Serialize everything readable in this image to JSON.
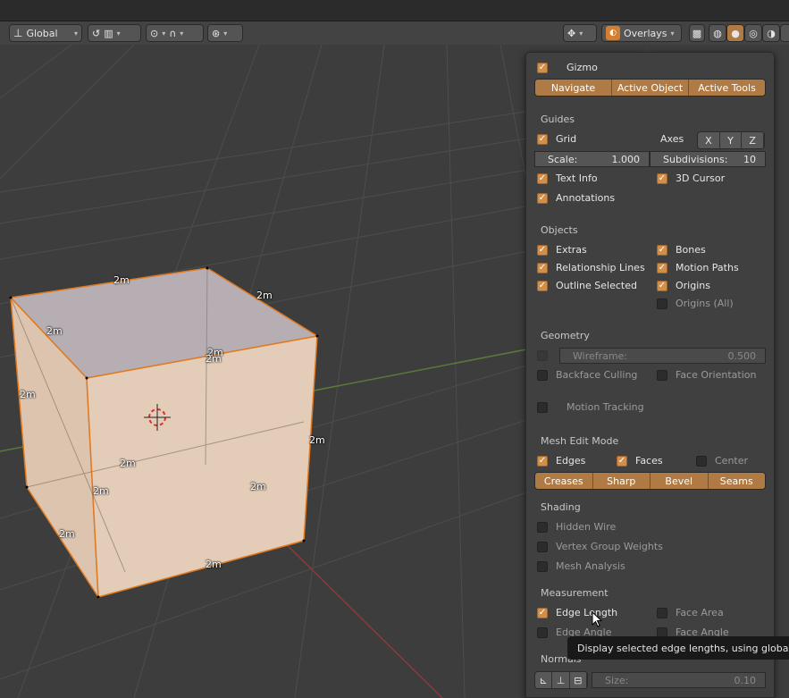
{
  "header": {
    "orientation": "Global",
    "overlays_label": "Overlays"
  },
  "viewport": {
    "measurements": [
      "2m",
      "2m",
      "2m",
      "2m",
      "2m",
      "2m",
      "2m",
      "2m",
      "2m",
      "2m",
      "2m",
      "2m",
      "2m",
      "2m"
    ]
  },
  "overlay": {
    "gizmo": {
      "label": "Gizmo",
      "checked": true,
      "buttons": [
        "Navigate",
        "Active Object",
        "Active Tools"
      ]
    },
    "guides": {
      "title": "Guides",
      "grid": "Grid",
      "axes_label": "Axes",
      "axes": [
        "X",
        "Y",
        "Z"
      ],
      "scale_label": "Scale:",
      "scale_value": "1.000",
      "subdivisions_label": "Subdivisions:",
      "subdivisions_value": "10",
      "text_info": "Text Info",
      "cursor_3d": "3D Cursor",
      "annotations": "Annotations"
    },
    "objects": {
      "title": "Objects",
      "extras": "Extras",
      "bones": "Bones",
      "relationship_lines": "Relationship Lines",
      "motion_paths": "Motion Paths",
      "outline_selected": "Outline Selected",
      "origins": "Origins",
      "origins_all": "Origins (All)"
    },
    "geometry": {
      "title": "Geometry",
      "wireframe_label": "Wireframe:",
      "wireframe_value": "0.500",
      "backface_culling": "Backface Culling",
      "face_orientation": "Face Orientation"
    },
    "motion_tracking": "Motion Tracking",
    "mesh_edit": {
      "title": "Mesh Edit Mode",
      "edges": "Edges",
      "faces": "Faces",
      "center": "Center",
      "buttons": [
        "Creases",
        "Sharp",
        "Bevel",
        "Seams"
      ]
    },
    "shading": {
      "title": "Shading",
      "hidden_wire": "Hidden Wire",
      "vertex_group_weights": "Vertex Group Weights",
      "mesh_analysis": "Mesh Analysis"
    },
    "measurement": {
      "title": "Measurement",
      "edge_length": "Edge Length",
      "face_area": "Face Area",
      "edge_angle": "Edge Angle",
      "face_angle": "Face Angle"
    },
    "normals": {
      "title": "Normals",
      "size_label": "Size:",
      "size_value": "0.10"
    }
  },
  "tooltip": "Display selected edge lengths, using global values",
  "colors": {
    "accent": "#d0904a",
    "panel": "#404040",
    "viewport": "#3d3d3d"
  }
}
